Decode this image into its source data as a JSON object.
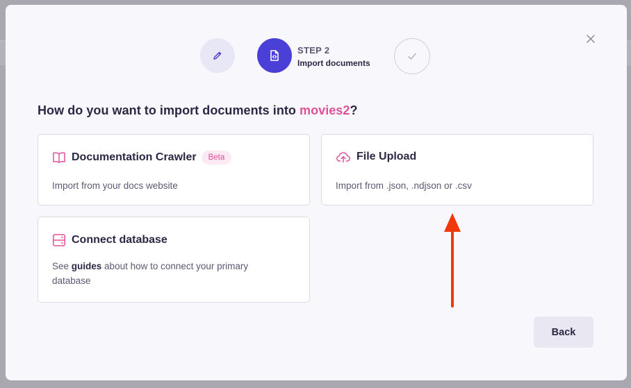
{
  "stepper": {
    "current_step_number": "STEP 2",
    "current_step_title": "Import documents"
  },
  "question": {
    "prefix": "How do you want to import documents into ",
    "collection": "movies2",
    "suffix": "?"
  },
  "options": {
    "crawler": {
      "title": "Documentation Crawler",
      "badge": "Beta",
      "description": "Import from your docs website"
    },
    "upload": {
      "title": "File Upload",
      "description": "Import from .json, .ndjson or .csv"
    },
    "database": {
      "title": "Connect database",
      "description_before": "See ",
      "description_link": "guides",
      "description_after": " about how to connect your primary database"
    }
  },
  "actions": {
    "back_label": "Back"
  },
  "icons": {
    "close": "close-icon",
    "step1": "pencil-icon",
    "step2": "file-code-icon",
    "step3": "check-icon",
    "crawler": "book-icon",
    "upload": "cloud-upload-icon",
    "database": "server-icon"
  },
  "colors": {
    "accent": "#e0509a",
    "primary": "#4a40d8",
    "annotation_arrow": "#f0380a"
  }
}
